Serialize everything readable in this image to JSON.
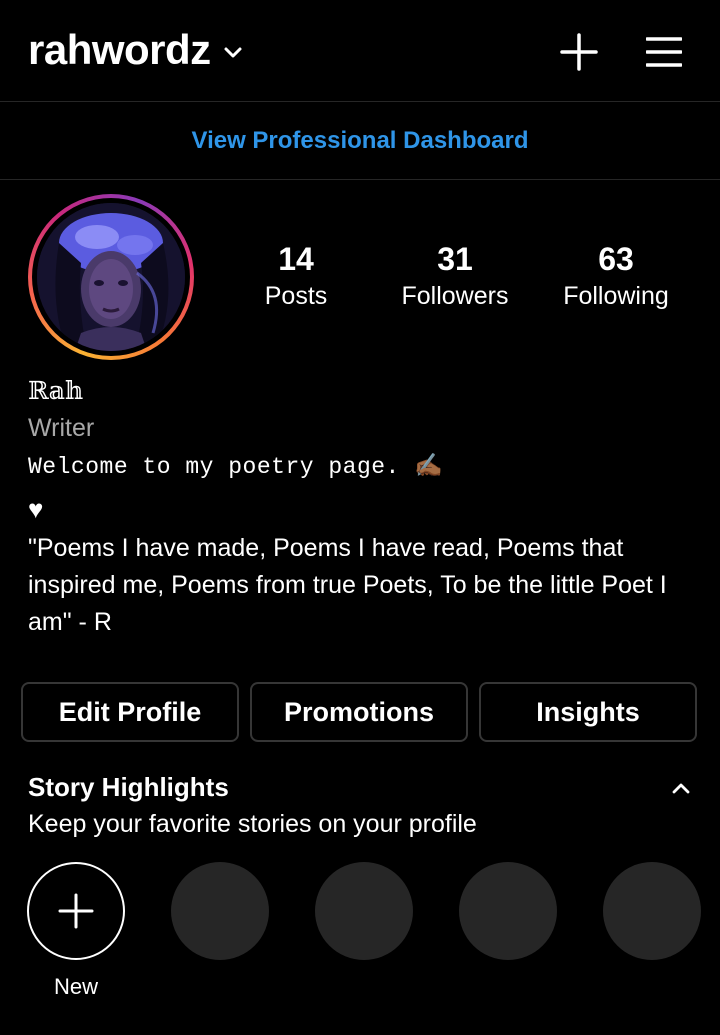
{
  "header": {
    "username": "rahwordz",
    "icons": {
      "chevron": "chevron-down-icon",
      "plus": "plus-icon",
      "menu": "hamburger-menu-icon"
    }
  },
  "dashboard_link": "View Professional Dashboard",
  "profile": {
    "stats": [
      {
        "value": "14",
        "label": "Posts"
      },
      {
        "value": "31",
        "label": "Followers"
      },
      {
        "value": "63",
        "label": "Following"
      }
    ],
    "name": "ℝ𝕒𝕙",
    "category": "Writer",
    "bio_line1": "Welcome to my poetry page. ✍🏾",
    "bio_heart": "♥",
    "bio_quote": "\"Poems I have made, Poems I have read, Poems that inspired me, Poems from true Poets, To be the little Poet I am\" - R"
  },
  "actions": {
    "edit_profile": "Edit Profile",
    "promotions": "Promotions",
    "insights": "Insights"
  },
  "highlights": {
    "title": "Story Highlights",
    "subtitle": "Keep your favorite stories on your profile",
    "new_label": "New"
  },
  "colors": {
    "background": "#000000",
    "accent_link": "#2f95e8",
    "muted_text": "#a8a8a8",
    "button_border": "#363636",
    "placeholder_circle": "#262626"
  }
}
